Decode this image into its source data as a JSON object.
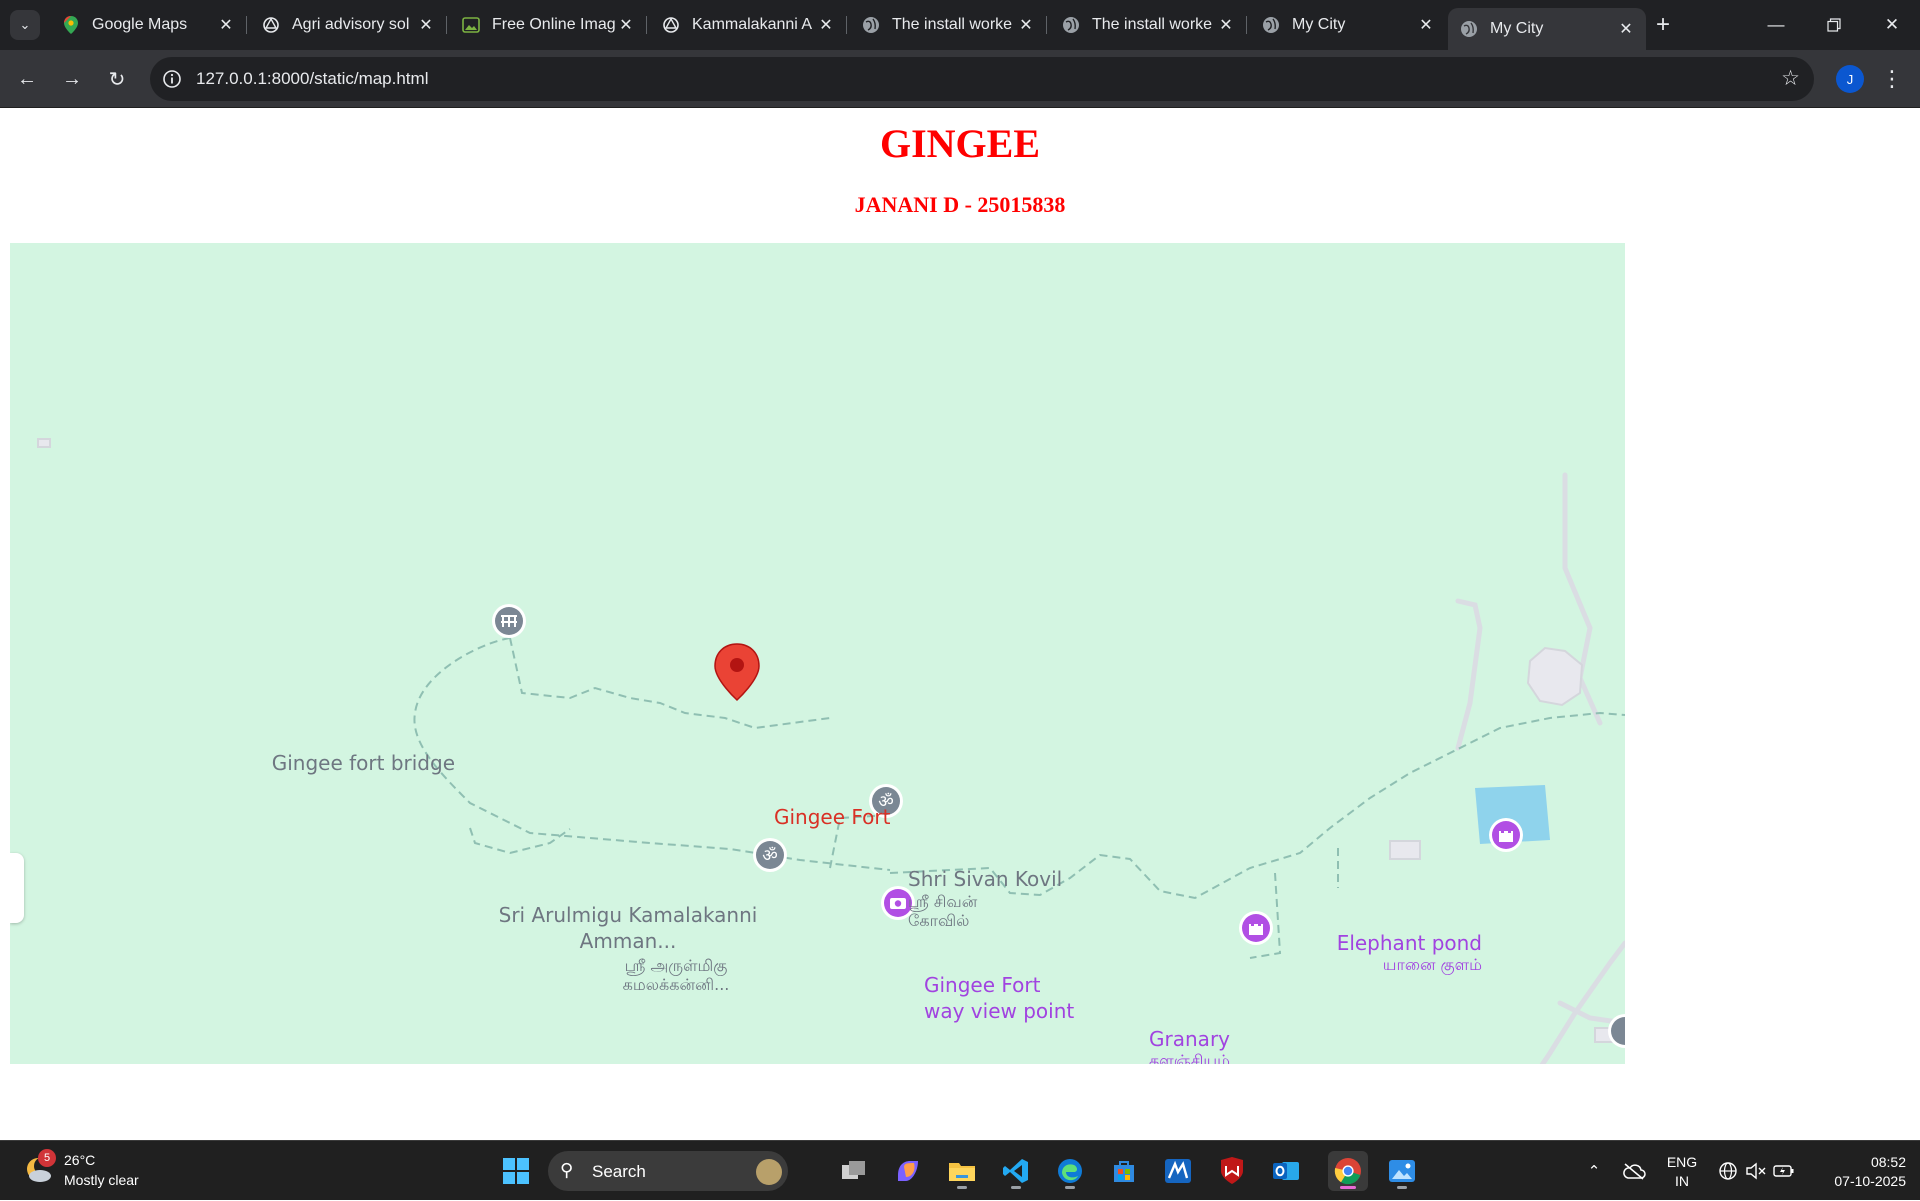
{
  "browser": {
    "tabs": [
      {
        "title": "Google Maps",
        "icon": "google-maps-favicon"
      },
      {
        "title": "Agri advisory sol",
        "icon": "chatgpt-favicon"
      },
      {
        "title": "Free Online Imag",
        "icon": "image-favicon"
      },
      {
        "title": "Kammalakanni A",
        "icon": "chatgpt-favicon"
      },
      {
        "title": "The install worke",
        "icon": "globe-favicon"
      },
      {
        "title": "The install worke",
        "icon": "globe-favicon"
      },
      {
        "title": "My City",
        "icon": "globe-favicon"
      },
      {
        "title": "My City",
        "icon": "globe-favicon",
        "active": true
      }
    ],
    "address": "127.0.0.1:8000/static/map.html",
    "profile_initial": "J"
  },
  "page": {
    "title": "GINGEE",
    "subtitle": "JANANI D - 25015838",
    "title_color": "#ff0000"
  },
  "map": {
    "background": "#d3f5e1",
    "main_marker": {
      "label": "Gingee Fort",
      "color": "#ea4335"
    },
    "places": [
      {
        "name": "Gingee fort bridge",
        "icon": "bridge-icon",
        "category": "landmark"
      },
      {
        "name": "Shri Sivan Kovil",
        "alt_name": "ஸ்ரீ சிவன் கோவில்",
        "icon": "om-temple-icon",
        "category": "temple"
      },
      {
        "name": "Sri Arulmigu Kamalakanni Amman...",
        "alt_name": "ஸ்ரீ அருள்மிகு கமலக்கன்னி...",
        "icon": "om-temple-icon",
        "category": "temple"
      },
      {
        "name": "Gingee Fort way view point",
        "icon": "camera-icon",
        "category": "attraction"
      },
      {
        "name": "Elephant pond",
        "alt_name": "யானை குளம்",
        "icon": "castle-icon",
        "category": "attraction"
      },
      {
        "name": "Granary",
        "alt_name": "களஞ்சியம்",
        "icon": "castle-icon",
        "category": "attraction"
      }
    ]
  },
  "taskbar": {
    "weather": {
      "temp": "26°C",
      "condition": "Mostly clear",
      "badge": "5"
    },
    "search_placeholder": "Search",
    "language": "ENG",
    "region": "IN",
    "time": "08:52",
    "date": "07-10-2025"
  }
}
